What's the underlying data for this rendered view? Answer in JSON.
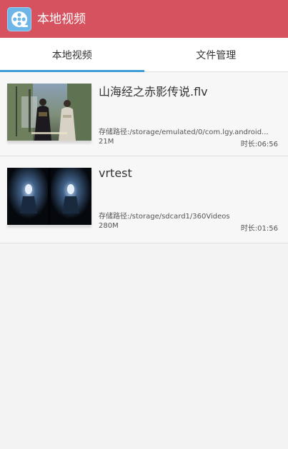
{
  "app": {
    "title": "本地视频"
  },
  "tabs": [
    {
      "label": "本地视频",
      "active": true
    },
    {
      "label": "文件管理",
      "active": false
    }
  ],
  "videos": [
    {
      "name": "山海经之赤影传说.flv",
      "path": "存储路径:/storage/emulated/0/com.lgy.android...",
      "size": "21M",
      "duration": "时长:06:56"
    },
    {
      "name": "vrtest",
      "path": "存储路径:/storage/sdcard1/360Videos",
      "size": "280M",
      "duration": "时长:01:56"
    }
  ],
  "colors": {
    "titlebar": "#d6525f",
    "tab_indicator": "#3d9bd5",
    "app_icon": "#6fb6e8"
  },
  "icons": {
    "app": "film-reel-icon"
  }
}
